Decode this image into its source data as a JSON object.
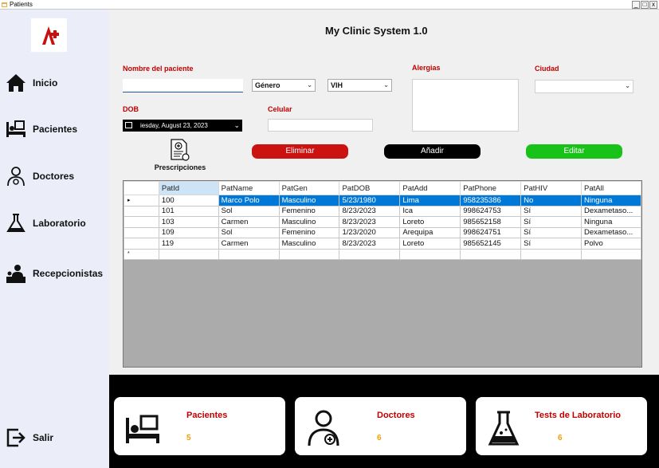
{
  "window": {
    "title": "Patients",
    "buttons": [
      "_",
      "□",
      "x"
    ]
  },
  "sidebar": {
    "items": [
      {
        "label": "Inicio",
        "icon": "home-icon"
      },
      {
        "label": "Pacientes",
        "icon": "patient-bed-icon"
      },
      {
        "label": "Doctores",
        "icon": "doctor-icon"
      },
      {
        "label": "Laboratorio",
        "icon": "flask-icon"
      },
      {
        "label": "Recepcionistas",
        "icon": "receptionist-icon"
      }
    ],
    "exit_label": "Salir"
  },
  "header": {
    "title": "My Clinic System 1.0"
  },
  "form": {
    "nombre_label": "Nombre del paciente",
    "nombre_value": "",
    "genero_value": "Género",
    "vih_value": "VIH",
    "alergias_label": "Alergias",
    "ciudad_label": "Ciudad",
    "ciudad_value": "",
    "dob_label": "DOB",
    "dob_value": "iesday, August 23, 2023",
    "celular_label": "Celular",
    "celular_value": ""
  },
  "actions": {
    "prescripciones": "Prescripciones",
    "eliminar": "Eliminar",
    "anadir": "Añadir",
    "editar": "Editar"
  },
  "colors": {
    "eliminar": "#cc1111",
    "anadir": "#000000",
    "editar": "#19c219",
    "accent": "#c00000",
    "count": "#f0a000"
  },
  "table": {
    "columns": [
      "PatId",
      "PatName",
      "PatGen",
      "PatDOB",
      "PatAdd",
      "PatPhone",
      "PatHIV",
      "PatAll"
    ],
    "rows": [
      [
        "100",
        "Marco Polo",
        "Masculino",
        "5/23/1980",
        "Lima",
        "958235386",
        "No",
        "Ninguna"
      ],
      [
        "101",
        "Sol",
        "Femenino",
        "8/23/2023",
        "Ica",
        "998624753",
        "Sí",
        "Dexametaso..."
      ],
      [
        "103",
        "Carmen",
        "Masculino",
        "8/23/2023",
        "Loreto",
        "985652158",
        "Sí",
        "Ninguna"
      ],
      [
        "109",
        "Sol",
        "Femenino",
        "1/23/2020",
        "Arequipa",
        "998624751",
        "Sí",
        "Dexametaso..."
      ],
      [
        "119",
        "Carmen",
        "Masculino",
        "8/23/2023",
        "Loreto",
        "985652145",
        "Sí",
        "Polvo"
      ]
    ],
    "selected_row_marker": "▸",
    "new_row_marker": "*"
  },
  "cards": [
    {
      "title": "Pacientes",
      "value": "5",
      "icon": "patient-bed-icon"
    },
    {
      "title": "Doctores",
      "value": "6",
      "icon": "doctor-icon"
    },
    {
      "title": "Tests de Laboratorio",
      "value": "6",
      "icon": "flask-icon"
    }
  ]
}
